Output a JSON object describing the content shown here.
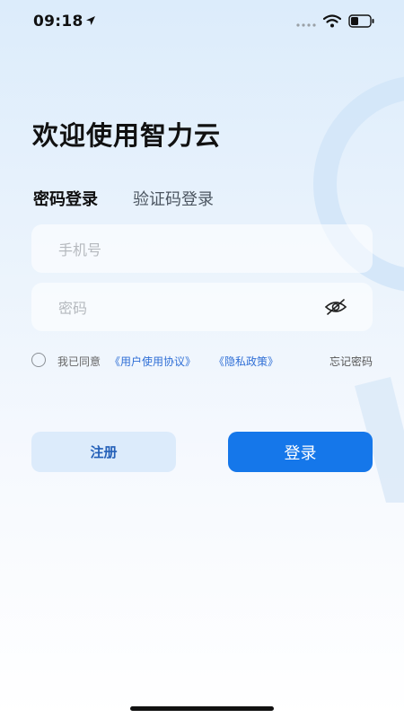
{
  "status_bar": {
    "time": "09:18"
  },
  "title": "欢迎使用智力云",
  "tabs": {
    "password_login": "密码登录",
    "code_login": "验证码登录"
  },
  "form": {
    "phone_placeholder": "手机号",
    "phone_value": "",
    "password_placeholder": "密码",
    "password_value": ""
  },
  "agreement": {
    "prefix": "我已同意",
    "user_agreement": "《用户使用协议》",
    "privacy_policy": "《隐私政策》",
    "forgot_password": "忘记密码"
  },
  "buttons": {
    "register": "注册",
    "login": "登录"
  },
  "colors": {
    "primary": "#1577ea",
    "secondary_bg": "#dcebfb",
    "link": "#2f6fd6"
  },
  "icons": {
    "password_visibility": "eye-off-icon"
  }
}
